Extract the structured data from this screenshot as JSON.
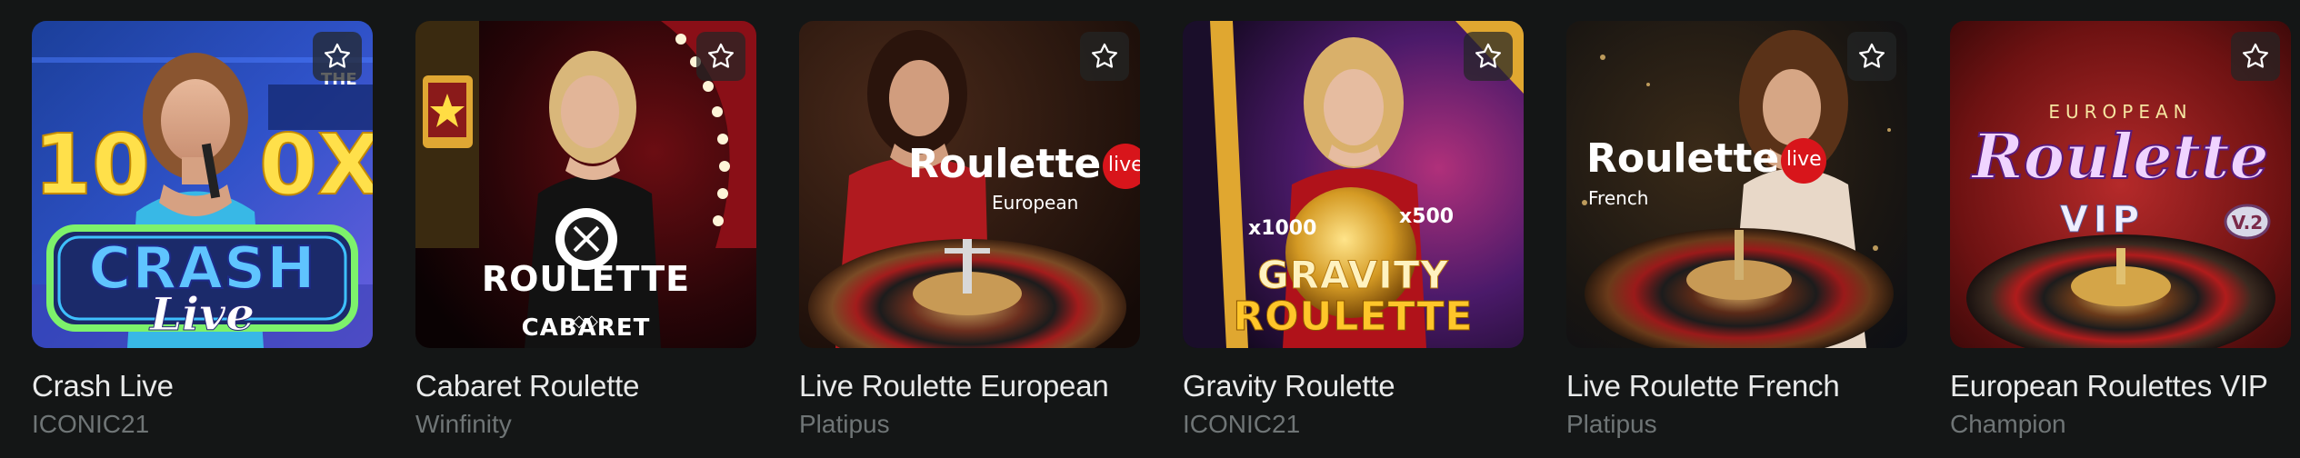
{
  "favorite_icon": "star-icon",
  "games": [
    {
      "title": "Crash Live",
      "provider": "ICONIC21",
      "art": {
        "main": "CRASH",
        "sub": "Live",
        "top": "10",
        "top_right": "0X",
        "sign": "THE"
      }
    },
    {
      "title": "Cabaret Roulette",
      "provider": "Winfinity",
      "art": {
        "main": "ROULETTE",
        "sub": "CABARET"
      }
    },
    {
      "title": "Live Roulette European",
      "provider": "Platipus",
      "art": {
        "main": "Roulette",
        "badge": "live",
        "sub": "European"
      }
    },
    {
      "title": "Gravity Roulette",
      "provider": "ICONIC21",
      "art": {
        "main": "GRAVITY",
        "sub": "ROULETTE",
        "mult_left": "x1000",
        "mult_right": "x500"
      }
    },
    {
      "title": "Live Roulette French",
      "provider": "Platipus",
      "art": {
        "main": "Roulette",
        "badge": "live",
        "sub": "French"
      }
    },
    {
      "title": "European Roulettes VIP",
      "provider": "Champion",
      "art": {
        "top": "EUROPEAN",
        "main": "Roulette",
        "sub": "VIP",
        "version": "V.2"
      }
    }
  ]
}
